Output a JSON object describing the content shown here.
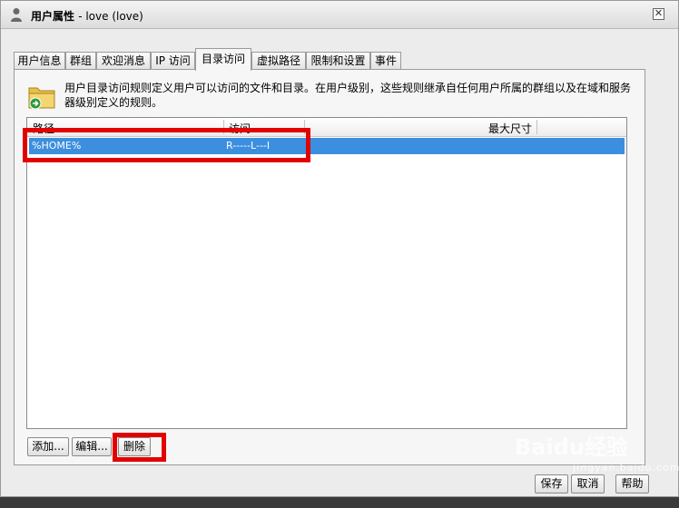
{
  "window": {
    "title": "用户属性",
    "title_suffix": "- love (love)",
    "close_glyph": "✕"
  },
  "tabs": [
    {
      "label": "用户信息"
    },
    {
      "label": "群组"
    },
    {
      "label": "欢迎消息"
    },
    {
      "label": "IP 访问"
    },
    {
      "label": "目录访问",
      "active": true
    },
    {
      "label": "虚拟路径"
    },
    {
      "label": "限制和设置"
    },
    {
      "label": "事件"
    }
  ],
  "panel": {
    "description": "用户目录访问规则定义用户可以访问的文件和目录。在用户级别，这些规则继承自任何用户所属的群组以及在域和服务器级别定义的规则。"
  },
  "list": {
    "columns": [
      "路径",
      "访问",
      "最大尺寸"
    ],
    "rows": [
      {
        "path": "%HOME%",
        "access": "R-----L---I",
        "max_size": ""
      }
    ]
  },
  "buttons": {
    "add": "添加...",
    "edit": "编辑...",
    "delete": "删除",
    "save": "保存",
    "cancel": "取消",
    "help": "帮助"
  },
  "watermark": {
    "brand": "Baidu经验",
    "sub": "jingyan.baidu.com"
  },
  "colors": {
    "selection": "#3c8fde",
    "highlight_box": "#e30000"
  }
}
